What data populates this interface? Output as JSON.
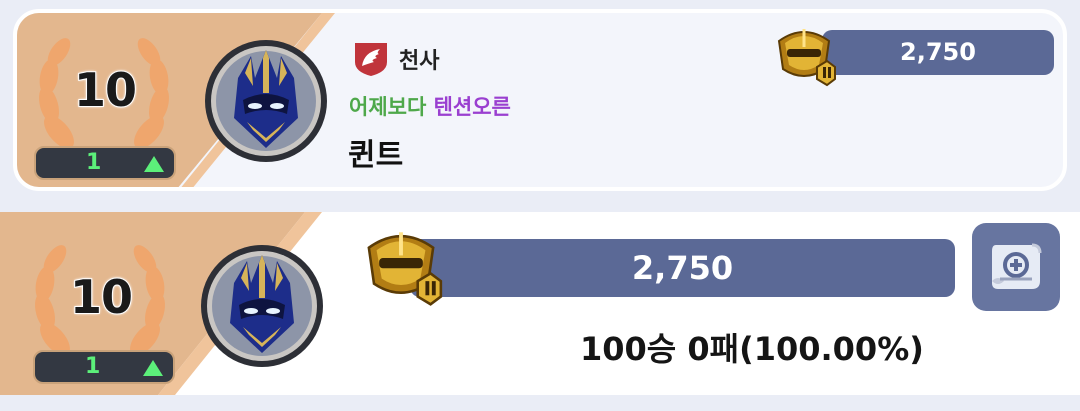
{
  "ranking_entry": {
    "rank": "10",
    "rank_change": "1",
    "guild_name": "천사",
    "title_part1": "어제보다",
    "title_part2": "텐션오른",
    "player_name": "퀸트",
    "score": "2,750"
  },
  "detail_entry": {
    "rank": "10",
    "rank_change": "1",
    "score": "2,750",
    "record": "100승 0패(100.00%)"
  },
  "colors": {
    "rank_panel": "#e3b78e",
    "laurel": "#efa66d",
    "score_bar": "#5b6996",
    "rank_up": "#5cf07a",
    "title_green": "#4ea84a",
    "title_purple": "#9a3fd0",
    "guild_red": "#c0343b"
  },
  "icons": [
    "laurel-wreath-icon",
    "knight-helmet-avatar",
    "angel-wing-guild-icon",
    "gold-helmet-tier-icon",
    "scroll-record-icon",
    "triangle-up-icon"
  ]
}
